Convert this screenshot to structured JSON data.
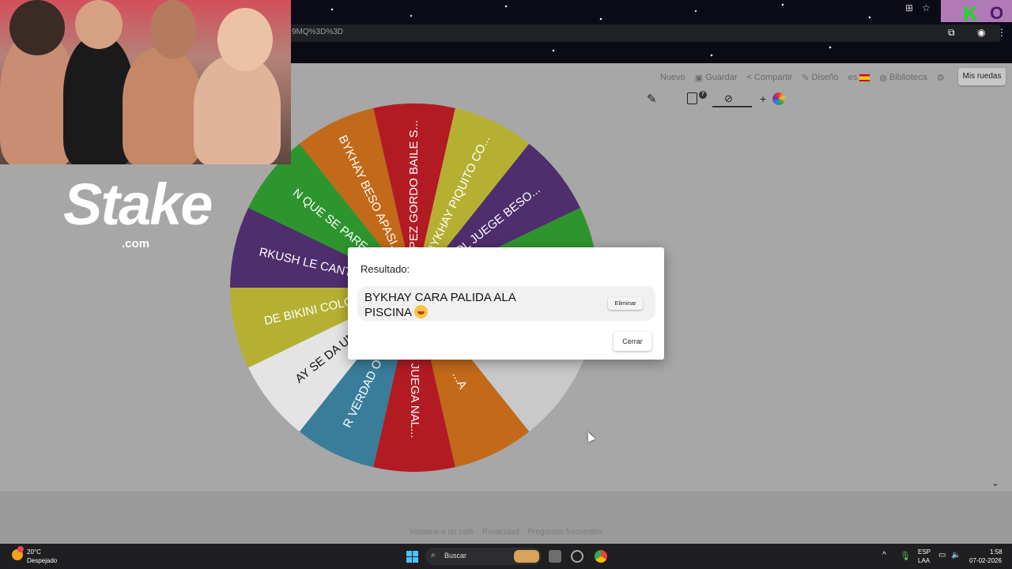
{
  "browser": {
    "address_text": "9MQ%3D%3D",
    "extension_badge": {
      "k": "K",
      "o": "O"
    }
  },
  "toolbar": {
    "nuevo": "Nuevo",
    "guardar": "Guardar",
    "compartir": "Compartir",
    "diseno": "Diseño",
    "lang": "es",
    "biblioteca": "Biblioteca",
    "mis_ruedas": "Mis ruedas",
    "clipboard_count": "7"
  },
  "wheel": {
    "segments": [
      {
        "label": "PEZ GORDO BAILE S...",
        "color": "#b31b23"
      },
      {
        "label": "BYKHAY PIQUITO CO...",
        "color": "#b5b032"
      },
      {
        "label": "SOL JUEGE BESO...",
        "color": "#4e2e6c"
      },
      {
        "label": "",
        "color": "#2d952e"
      },
      {
        "label": "",
        "color": "#c9c9c9"
      },
      {
        "label": "",
        "color": "#c9c9c9"
      },
      {
        "label": "...A",
        "color": "#c26a19"
      },
      {
        "label": "SH JUEGA NAL...",
        "color": "#b31b23"
      },
      {
        "label": "R VERDAD O RE...",
        "color": "#3a7d9b"
      },
      {
        "label": "AY SE DA UN P...",
        "color": "#e4e4e4"
      },
      {
        "label": "DE BIKINI COLO...",
        "color": "#b5b032"
      },
      {
        "label": "RKUSH LE CANTA...",
        "color": "#4e2e6c"
      },
      {
        "label": "N QUE SE PARE...",
        "color": "#2d952e"
      },
      {
        "label": "BYKHAY BESO APASI...",
        "color": "#c26a19"
      }
    ]
  },
  "overlay": {
    "stake_logo": "Stake",
    "stake_com": ".com"
  },
  "modal": {
    "title": "Resultado:",
    "result": "BYKHAY CARA PALIDA ALA PISCINA",
    "eliminar": "Eliminar",
    "cerrar": "Cerrar"
  },
  "footer": {
    "link1": "Invitame a un café",
    "link2": "Privacidad",
    "link3": "Preguntas frecuentes"
  },
  "taskbar": {
    "temp": "20°C",
    "weather": "Despejado",
    "search_placeholder": "Buscar",
    "lang1": "ESP",
    "lang2": "LAA",
    "time": "1:58",
    "date": "07-02-2026"
  },
  "colors": {
    "modal_bg": "#ffffff",
    "page_bg": "#a7a7a7",
    "taskbar_bg": "#1f1f21"
  }
}
